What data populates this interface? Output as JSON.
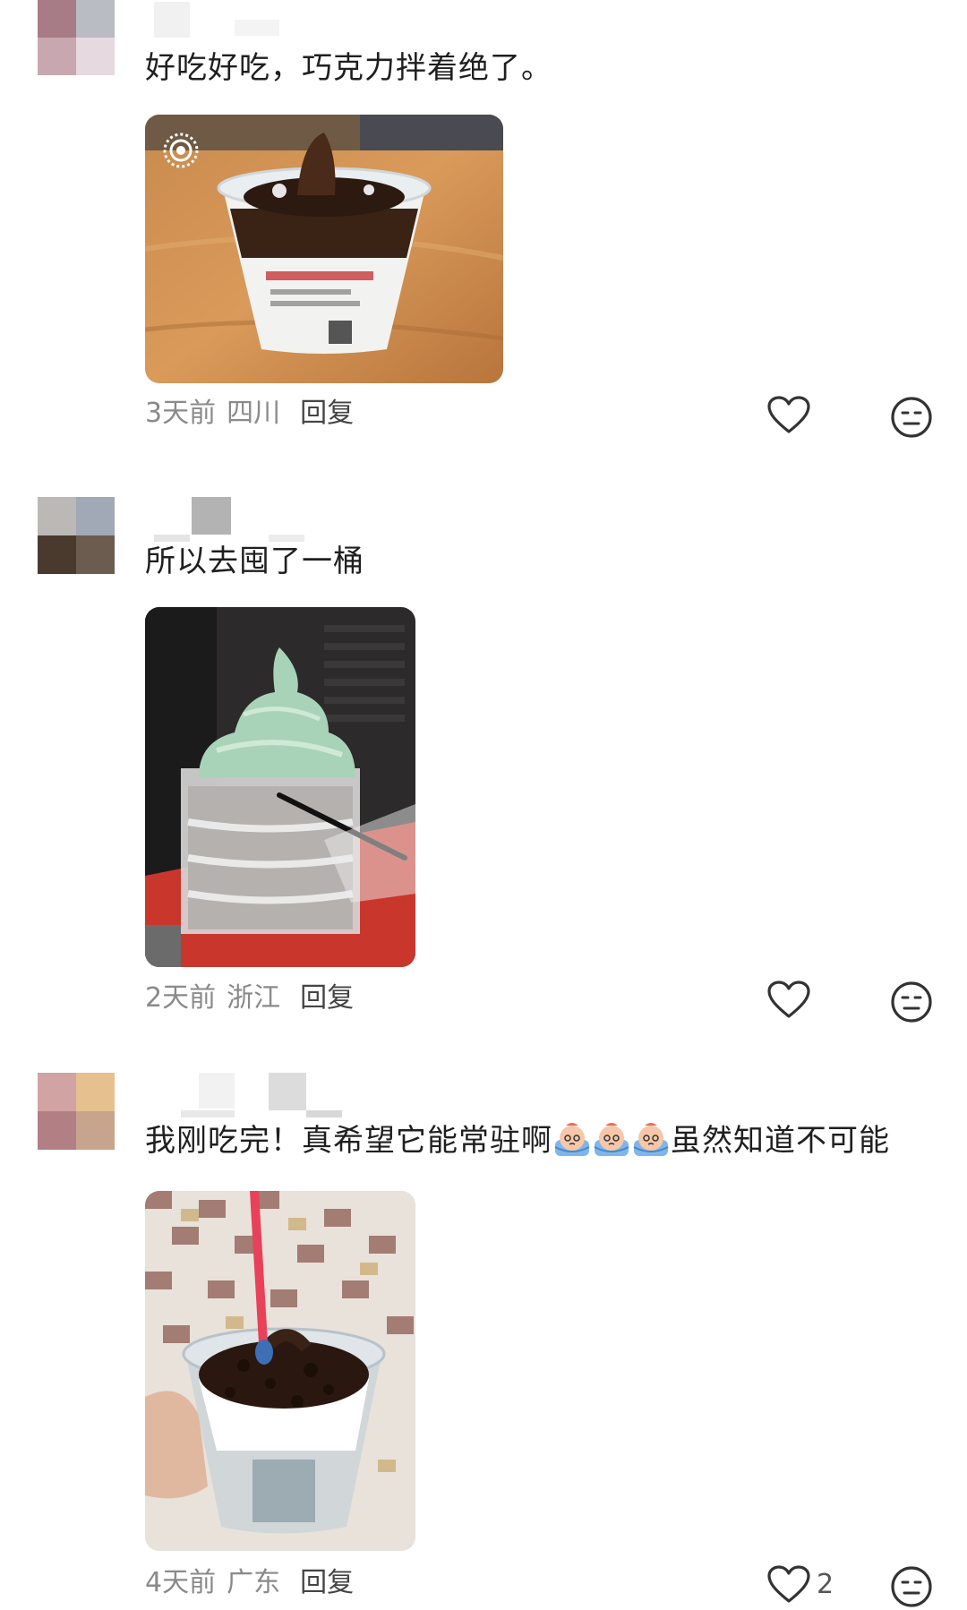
{
  "comments": [
    {
      "text": "好吃好吃，巧克力拌着绝了。",
      "time": "3天前",
      "region": "四川",
      "reply_label": "回复",
      "photo_label": "Live"
    },
    {
      "text": "所以去囤了一桶",
      "time": "2天前",
      "region": "浙江",
      "reply_label": "回复"
    },
    {
      "text_before_emoji": "我刚吃完！真希望它能常驻啊",
      "text_after_emoji": "虽然知道不可能",
      "emoji_name": "crying-face-emoji",
      "time": "4天前",
      "region": "广东",
      "reply_label": "回复",
      "like_count": "2"
    }
  ],
  "icons": {
    "like": "heart-outline-icon",
    "dislike": "neutral-face-icon"
  },
  "colors": {
    "text": "#1f1f1f",
    "meta": "#8a8a8a",
    "reply": "#444444",
    "icon": "#333333"
  }
}
